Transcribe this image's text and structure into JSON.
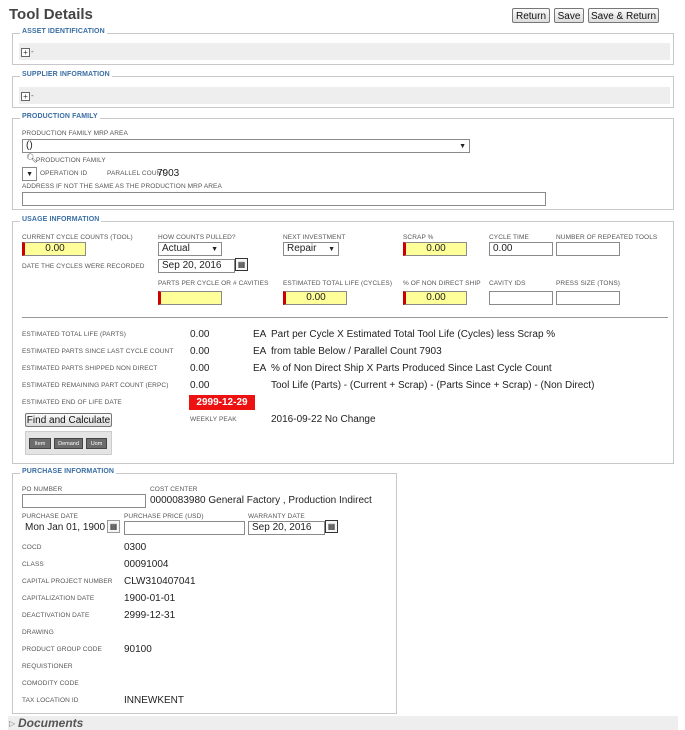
{
  "page": {
    "title": "Tool Details"
  },
  "toolbar": {
    "return_label": "Return",
    "save_label": "Save",
    "save_return_label": "Save & Return"
  },
  "asset": {
    "legend": "ASSET IDENTIFICATION",
    "expand_text": "-"
  },
  "supplier": {
    "legend": "SUPPLIER INFORMATION",
    "expand_text": "-"
  },
  "production": {
    "legend": "PRODUCTION FAMILY",
    "mrp_area_label": "PRODUCTION FAMILY MRP AREA",
    "mrp_area_value": "()",
    "family_label": "PRODUCTION FAMILY",
    "operation_id_label": "OPERATION ID",
    "parallel_count_label": "PARALLEL COUNT",
    "parallel_count_value": "7903",
    "address_label": "ADDRESS IF NOT THE SAME AS THE PRODUCTION MRP AREA",
    "address_value": ""
  },
  "usage": {
    "legend": "USAGE INFORMATION",
    "current_cycle_label": "CURRENT CYCLE COUNTS (TOOL)",
    "current_cycle_value": "0.00",
    "how_counts_label": "HOW COUNTS PULLED?",
    "how_counts_value": "Actual",
    "next_investment_label": "NEXT INVESTMENT",
    "next_investment_value": "Repair",
    "scrap_label": "SCRAP %",
    "scrap_value": "0.00",
    "cycle_time_label": "CYCLE TIME",
    "cycle_time_value": "0.00",
    "repeated_tools_label": "NUMBER OF REPEATED TOOLS",
    "repeated_tools_value": "",
    "date_recorded_label": "DATE THE CYCLES WERE RECORDED",
    "date_recorded_value": "Sep 20, 2016",
    "parts_per_cycle_label": "PARTS PER CYCLE OR # CAVITIES",
    "parts_per_cycle_value": "",
    "est_total_life_cycles_label": "ESTIMATED TOTAL LIFE (CYCLES)",
    "est_total_life_cycles_value": "0.00",
    "pct_non_direct_label": "% OF NON DIRECT SHIP",
    "pct_non_direct_value": "0.00",
    "cavity_ids_label": "CAVITY IDS",
    "cavity_ids_value": "",
    "press_size_label": "PRESS SIZE (TONS)",
    "press_size_value": "",
    "calc_rows": [
      {
        "label": "ESTIMATED TOTAL LIFE (PARTS)",
        "value": "0.00",
        "unit": "EA",
        "formula": "Part per Cycle X Estimated Total Tool Life (Cycles) less Scrap %"
      },
      {
        "label": "ESTIMATED PARTS SINCE LAST CYCLE COUNT",
        "value": "0.00",
        "unit": "EA",
        "formula": "from table Below / Parallel Count 7903"
      },
      {
        "label": "ESTIMATED PARTS SHIPPED NON DIRECT",
        "value": "0.00",
        "unit": "EA",
        "formula": "% of Non Direct Ship X Parts Produced Since Last Cycle Count"
      },
      {
        "label": "ESTIMATED REMAINING PART COUNT (ERPC)",
        "value": "0.00",
        "unit": "",
        "formula": "Tool Life (Parts) - (Current + Scrap) - (Parts Since + Scrap) - (Non Direct)"
      }
    ],
    "end_of_life_label": "ESTIMATED END OF LIFE DATE",
    "end_of_life_value": "2999-12-29",
    "find_calc_label": "Find and Calculate",
    "weekly_peak_label": "WEEKLY PEAK",
    "weekly_peak_value": "2016-09-22 No Change",
    "mini_buttons": [
      "Item",
      "Demand",
      "Uom"
    ]
  },
  "purchase": {
    "legend": "PURCHASE INFORMATION",
    "po_number_label": "PO NUMBER",
    "po_number_value": "",
    "cost_center_label": "COST CENTER",
    "cost_center_value": "0000083980 General Factory ,  Production Indirect",
    "purchase_date_label": "PURCHASE DATE",
    "purchase_date_value": "Mon Jan 01, 1900",
    "purchase_price_label": "PURCHASE PRICE (USD)",
    "purchase_price_value": "",
    "warranty_date_label": "WARRANTY DATE",
    "warranty_date_value": "Sep 20, 2016",
    "rows": [
      {
        "label": "COCD",
        "value": "0300"
      },
      {
        "label": "CLASS",
        "value": "00091004"
      },
      {
        "label": "CAPITAL PROJECT NUMBER",
        "value": "CLW310407041"
      },
      {
        "label": "CAPITALIZATION DATE",
        "value": "1900-01-01"
      },
      {
        "label": "DEACTIVATION DATE",
        "value": "2999-12-31"
      },
      {
        "label": "DRAWING",
        "value": ""
      },
      {
        "label": "PRODUCT GROUP CODE",
        "value": "90100"
      },
      {
        "label": "REQUISTIONER",
        "value": ""
      },
      {
        "label": "COMODITY CODE",
        "value": ""
      },
      {
        "label": "TAX LOCATION ID",
        "value": "INNEWKENT"
      }
    ]
  },
  "documents": {
    "label": "Documents"
  },
  "icons": {
    "expand": "plus-box-icon",
    "calendar": "calendar-icon",
    "search": "magnifier-icon",
    "dropdown": "chevron-down-icon"
  },
  "colors": {
    "required_fill": "#ffff99",
    "required_border": "#cc0000",
    "end_of_life_bg": "#ee1111",
    "legend_text": "#3a6ea5"
  }
}
